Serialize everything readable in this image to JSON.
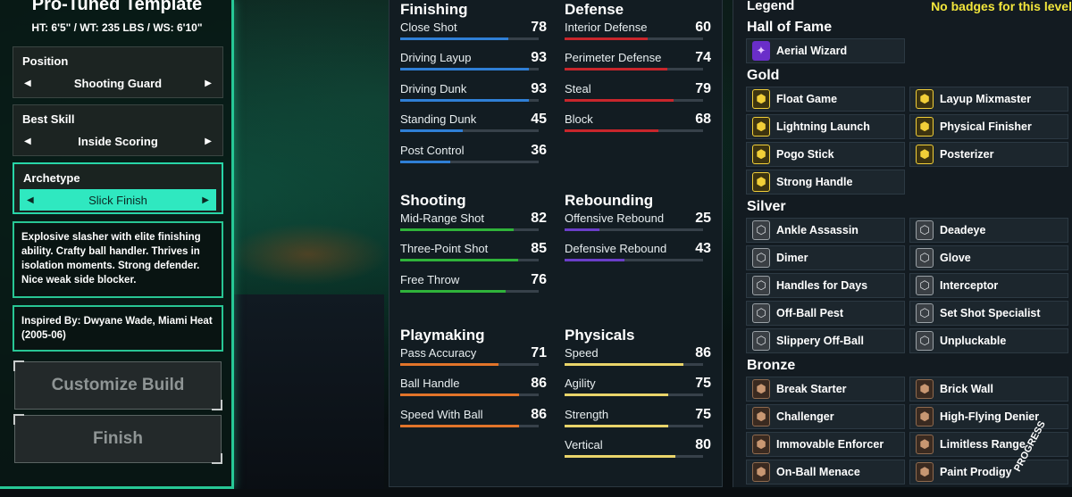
{
  "template": {
    "title": "Pro-Tuned Template",
    "meta": "HT: 6'5\" / WT: 235 LBS / WS: 6'10\"",
    "position": {
      "label": "Position",
      "value": "Shooting Guard"
    },
    "best_skill": {
      "label": "Best Skill",
      "value": "Inside Scoring"
    },
    "archetype": {
      "label": "Archetype",
      "value": "Slick Finish"
    },
    "description": "Explosive slasher with elite finishing ability. Crafty ball handler. Thrives in isolation moments. Strong defender. Nice weak side blocker.",
    "inspired_by": "Inspired By: Dwyane Wade, Miami Heat (2005-06)",
    "customize_label": "Customize Build",
    "finish_label": "Finish"
  },
  "stats": {
    "finishing": {
      "title": "Finishing",
      "items": [
        {
          "name": "Close Shot",
          "value": "78"
        },
        {
          "name": "Driving Layup",
          "value": "93"
        },
        {
          "name": "Driving Dunk",
          "value": "93"
        },
        {
          "name": "Standing Dunk",
          "value": "45"
        },
        {
          "name": "Post Control",
          "value": "36"
        }
      ]
    },
    "defense": {
      "title": "Defense",
      "items": [
        {
          "name": "Interior Defense",
          "value": "60"
        },
        {
          "name": "Perimeter Defense",
          "value": "74"
        },
        {
          "name": "Steal",
          "value": "79"
        },
        {
          "name": "Block",
          "value": "68"
        }
      ]
    },
    "shooting": {
      "title": "Shooting",
      "items": [
        {
          "name": "Mid-Range Shot",
          "value": "82"
        },
        {
          "name": "Three-Point Shot",
          "value": "85"
        },
        {
          "name": "Free Throw",
          "value": "76"
        }
      ]
    },
    "rebounding": {
      "title": "Rebounding",
      "items": [
        {
          "name": "Offensive Rebound",
          "value": "25"
        },
        {
          "name": "Defensive Rebound",
          "value": "43"
        }
      ]
    },
    "playmaking": {
      "title": "Playmaking",
      "items": [
        {
          "name": "Pass Accuracy",
          "value": "71"
        },
        {
          "name": "Ball Handle",
          "value": "86"
        },
        {
          "name": "Speed With Ball",
          "value": "86"
        }
      ]
    },
    "physicals": {
      "title": "Physicals",
      "items": [
        {
          "name": "Speed",
          "value": "86"
        },
        {
          "name": "Agility",
          "value": "75"
        },
        {
          "name": "Strength",
          "value": "75"
        },
        {
          "name": "Vertical",
          "value": "80"
        }
      ]
    }
  },
  "colors": {
    "finishing": "#2f7fd6",
    "defense": "#c8262c",
    "shooting": "#2fb33a",
    "rebounding": "#6a3ec8",
    "playmaking": "#e2742a",
    "physicals": "#e9d46a"
  },
  "legend": {
    "title": "Legend",
    "notice": "No badges for this level",
    "hof_title": "Hall of Fame",
    "gold_title": "Gold",
    "silver_title": "Silver",
    "bronze_title": "Bronze",
    "hof": [
      {
        "name": "Aerial Wizard",
        "icon": "wings-icon"
      }
    ],
    "gold": [
      {
        "name": "Float Game",
        "icon": "float-icon"
      },
      {
        "name": "Layup Mixmaster",
        "icon": "layup-icon"
      },
      {
        "name": "Lightning Launch",
        "icon": "lightning-icon"
      },
      {
        "name": "Physical Finisher",
        "icon": "fist-icon"
      },
      {
        "name": "Pogo Stick",
        "icon": "pogo-icon"
      },
      {
        "name": "Posterizer",
        "icon": "dunk-icon"
      },
      {
        "name": "Strong Handle",
        "icon": "handle-icon"
      }
    ],
    "silver": [
      {
        "name": "Ankle Assassin",
        "icon": "ankle-icon"
      },
      {
        "name": "Deadeye",
        "icon": "eye-icon"
      },
      {
        "name": "Dimer",
        "icon": "pass-icon"
      },
      {
        "name": "Glove",
        "icon": "glove-icon"
      },
      {
        "name": "Handles for Days",
        "icon": "dribble-icon"
      },
      {
        "name": "Interceptor",
        "icon": "intercept-icon"
      },
      {
        "name": "Off-Ball Pest",
        "icon": "pest-icon"
      },
      {
        "name": "Set Shot Specialist",
        "icon": "shot-icon"
      },
      {
        "name": "Slippery Off-Ball",
        "icon": "slippery-icon"
      },
      {
        "name": "Unpluckable",
        "icon": "lock-icon"
      }
    ],
    "bronze": [
      {
        "name": "Break Starter",
        "icon": "break-icon"
      },
      {
        "name": "Brick Wall",
        "icon": "wall-icon"
      },
      {
        "name": "Challenger",
        "icon": "challenge-icon"
      },
      {
        "name": "High-Flying Denier",
        "icon": "block-icon"
      },
      {
        "name": "Immovable Enforcer",
        "icon": "enforcer-icon"
      },
      {
        "name": "Limitless Range",
        "icon": "range-icon"
      },
      {
        "name": "On-Ball Menace",
        "icon": "menace-icon"
      },
      {
        "name": "Paint Prodigy",
        "icon": "paint-icon"
      }
    ]
  },
  "watermark": "PROGRESS"
}
